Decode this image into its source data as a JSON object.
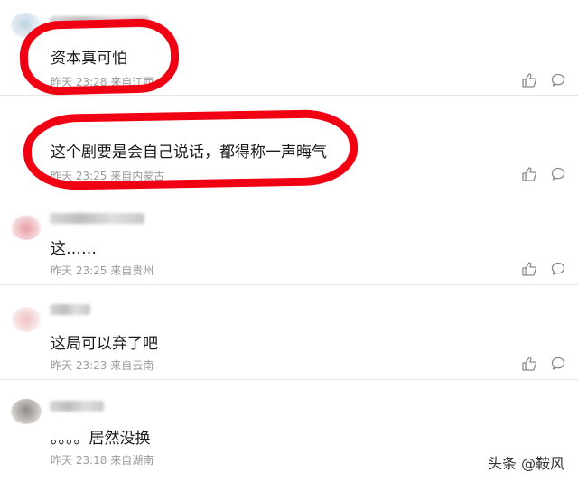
{
  "comments": [
    {
      "text": "资本真可怕",
      "time": "昨天 23:28",
      "location": "来自江西"
    },
    {
      "text": "这个剧要是会自己说话，都得称一声晦气",
      "time": "昨天 23:25",
      "location": "来自内蒙古"
    },
    {
      "text": "这……",
      "time": "昨天 23:25",
      "location": "来自贵州"
    },
    {
      "text": "这局可以弃了吧",
      "time": "昨天 23:23",
      "location": "来自云南"
    },
    {
      "text": "。。。。居然没换",
      "time": "昨天 23:18",
      "location": "来自湖南"
    }
  ],
  "watermark": "头条 @鞍风",
  "colors": {
    "highlight_circle": "#f00012",
    "meta_text": "#9a9a9a"
  },
  "icons": {
    "like": "thumbs-up-icon",
    "reply": "comment-bubble-icon"
  }
}
